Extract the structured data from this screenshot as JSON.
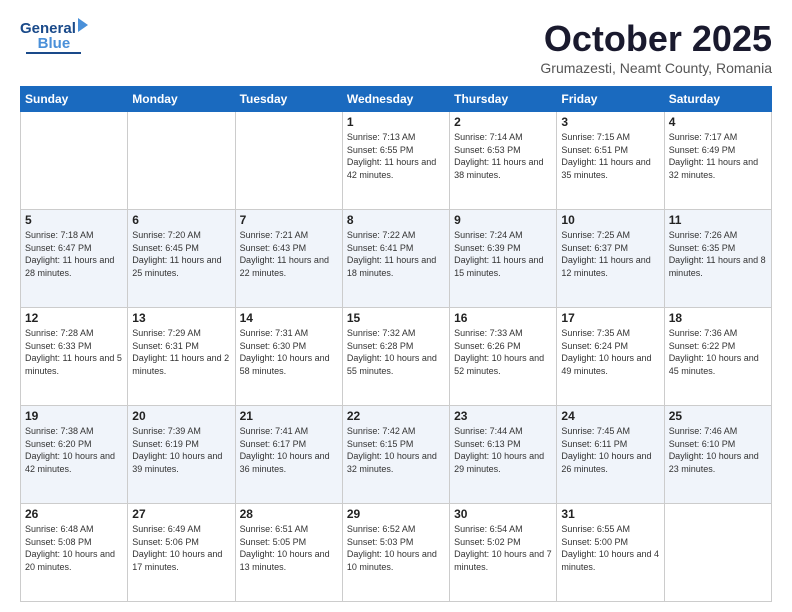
{
  "header": {
    "logo": {
      "line1": "General",
      "line2": "Blue"
    },
    "title": "October 2025",
    "subtitle": "Grumazesti, Neamt County, Romania"
  },
  "days_of_week": [
    "Sunday",
    "Monday",
    "Tuesday",
    "Wednesday",
    "Thursday",
    "Friday",
    "Saturday"
  ],
  "weeks": [
    [
      {
        "day": "",
        "info": ""
      },
      {
        "day": "",
        "info": ""
      },
      {
        "day": "",
        "info": ""
      },
      {
        "day": "1",
        "info": "Sunrise: 7:13 AM\nSunset: 6:55 PM\nDaylight: 11 hours\nand 42 minutes."
      },
      {
        "day": "2",
        "info": "Sunrise: 7:14 AM\nSunset: 6:53 PM\nDaylight: 11 hours\nand 38 minutes."
      },
      {
        "day": "3",
        "info": "Sunrise: 7:15 AM\nSunset: 6:51 PM\nDaylight: 11 hours\nand 35 minutes."
      },
      {
        "day": "4",
        "info": "Sunrise: 7:17 AM\nSunset: 6:49 PM\nDaylight: 11 hours\nand 32 minutes."
      }
    ],
    [
      {
        "day": "5",
        "info": "Sunrise: 7:18 AM\nSunset: 6:47 PM\nDaylight: 11 hours\nand 28 minutes."
      },
      {
        "day": "6",
        "info": "Sunrise: 7:20 AM\nSunset: 6:45 PM\nDaylight: 11 hours\nand 25 minutes."
      },
      {
        "day": "7",
        "info": "Sunrise: 7:21 AM\nSunset: 6:43 PM\nDaylight: 11 hours\nand 22 minutes."
      },
      {
        "day": "8",
        "info": "Sunrise: 7:22 AM\nSunset: 6:41 PM\nDaylight: 11 hours\nand 18 minutes."
      },
      {
        "day": "9",
        "info": "Sunrise: 7:24 AM\nSunset: 6:39 PM\nDaylight: 11 hours\nand 15 minutes."
      },
      {
        "day": "10",
        "info": "Sunrise: 7:25 AM\nSunset: 6:37 PM\nDaylight: 11 hours\nand 12 minutes."
      },
      {
        "day": "11",
        "info": "Sunrise: 7:26 AM\nSunset: 6:35 PM\nDaylight: 11 hours\nand 8 minutes."
      }
    ],
    [
      {
        "day": "12",
        "info": "Sunrise: 7:28 AM\nSunset: 6:33 PM\nDaylight: 11 hours\nand 5 minutes."
      },
      {
        "day": "13",
        "info": "Sunrise: 7:29 AM\nSunset: 6:31 PM\nDaylight: 11 hours\nand 2 minutes."
      },
      {
        "day": "14",
        "info": "Sunrise: 7:31 AM\nSunset: 6:30 PM\nDaylight: 10 hours\nand 58 minutes."
      },
      {
        "day": "15",
        "info": "Sunrise: 7:32 AM\nSunset: 6:28 PM\nDaylight: 10 hours\nand 55 minutes."
      },
      {
        "day": "16",
        "info": "Sunrise: 7:33 AM\nSunset: 6:26 PM\nDaylight: 10 hours\nand 52 minutes."
      },
      {
        "day": "17",
        "info": "Sunrise: 7:35 AM\nSunset: 6:24 PM\nDaylight: 10 hours\nand 49 minutes."
      },
      {
        "day": "18",
        "info": "Sunrise: 7:36 AM\nSunset: 6:22 PM\nDaylight: 10 hours\nand 45 minutes."
      }
    ],
    [
      {
        "day": "19",
        "info": "Sunrise: 7:38 AM\nSunset: 6:20 PM\nDaylight: 10 hours\nand 42 minutes."
      },
      {
        "day": "20",
        "info": "Sunrise: 7:39 AM\nSunset: 6:19 PM\nDaylight: 10 hours\nand 39 minutes."
      },
      {
        "day": "21",
        "info": "Sunrise: 7:41 AM\nSunset: 6:17 PM\nDaylight: 10 hours\nand 36 minutes."
      },
      {
        "day": "22",
        "info": "Sunrise: 7:42 AM\nSunset: 6:15 PM\nDaylight: 10 hours\nand 32 minutes."
      },
      {
        "day": "23",
        "info": "Sunrise: 7:44 AM\nSunset: 6:13 PM\nDaylight: 10 hours\nand 29 minutes."
      },
      {
        "day": "24",
        "info": "Sunrise: 7:45 AM\nSunset: 6:11 PM\nDaylight: 10 hours\nand 26 minutes."
      },
      {
        "day": "25",
        "info": "Sunrise: 7:46 AM\nSunset: 6:10 PM\nDaylight: 10 hours\nand 23 minutes."
      }
    ],
    [
      {
        "day": "26",
        "info": "Sunrise: 6:48 AM\nSunset: 5:08 PM\nDaylight: 10 hours\nand 20 minutes."
      },
      {
        "day": "27",
        "info": "Sunrise: 6:49 AM\nSunset: 5:06 PM\nDaylight: 10 hours\nand 17 minutes."
      },
      {
        "day": "28",
        "info": "Sunrise: 6:51 AM\nSunset: 5:05 PM\nDaylight: 10 hours\nand 13 minutes."
      },
      {
        "day": "29",
        "info": "Sunrise: 6:52 AM\nSunset: 5:03 PM\nDaylight: 10 hours\nand 10 minutes."
      },
      {
        "day": "30",
        "info": "Sunrise: 6:54 AM\nSunset: 5:02 PM\nDaylight: 10 hours\nand 7 minutes."
      },
      {
        "day": "31",
        "info": "Sunrise: 6:55 AM\nSunset: 5:00 PM\nDaylight: 10 hours\nand 4 minutes."
      },
      {
        "day": "",
        "info": ""
      }
    ]
  ]
}
